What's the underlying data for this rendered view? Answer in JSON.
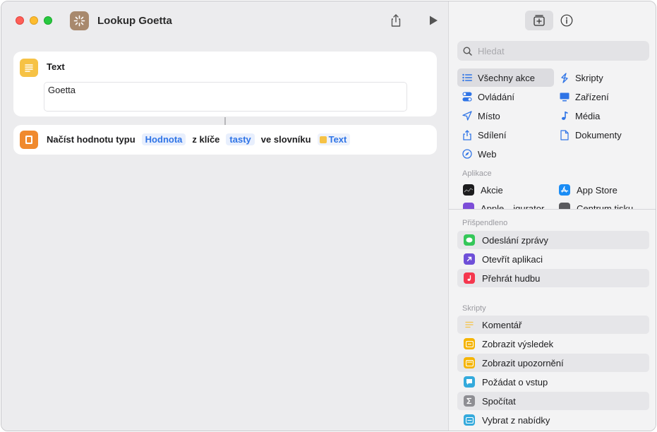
{
  "window": {
    "title": "Lookup Goetta"
  },
  "actions": [
    {
      "title": "Text",
      "value": "Goetta"
    },
    {
      "words": [
        "Načíst hodnotu typu",
        "z klíče",
        "ve slovníku"
      ],
      "tokens": [
        "Hodnota",
        "tasty"
      ],
      "variable": "Text"
    }
  ],
  "sidebar": {
    "search_placeholder": "Hledat",
    "categories_left": [
      "Všechny akce",
      "Ovládání",
      "Místo",
      "Sdílení",
      "Web"
    ],
    "categories_right": [
      "Skripty",
      "Zařízení",
      "Média",
      "Dokumenty"
    ],
    "apps_label": "Aplikace",
    "apps": [
      "Akcie",
      "App Store",
      "Apple…igurator",
      "Centrum tisku"
    ],
    "pinned_label": "Přišpendleno",
    "pinned": [
      "Odeslání zprávy",
      "Otevřít aplikaci",
      "Přehrát hudbu"
    ],
    "scripts_label": "Skripty",
    "scripts": [
      "Komentář",
      "Zobrazit výsledek",
      "Zobrazit upozornění",
      "Požádat o vstup",
      "Spočítat",
      "Vybrat z nabídky"
    ]
  },
  "colors": {
    "accent": "#2f74e6",
    "text_action": "#f6c245",
    "dict_action": "#f08a2e",
    "shortcut_icon": "#a8896d"
  }
}
